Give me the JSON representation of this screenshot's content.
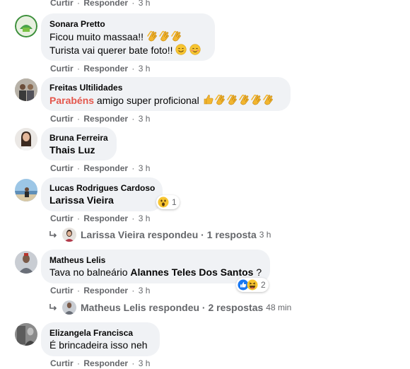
{
  "actions": {
    "like": "Curtir",
    "reply": "Responder",
    "sep": "·"
  },
  "comments": [
    {
      "id": "top",
      "time": "3 h"
    },
    {
      "id": "sonara",
      "author": "Sonara Pretto",
      "line1": "Ficou muito massaa!!",
      "line2": "Turista vai querer bate foto!!",
      "time": "3 h"
    },
    {
      "id": "freitas",
      "author": "Freitas Ultilidades",
      "highlight": "Parabéns",
      "text": " amigo super proficional",
      "time": "3 h"
    },
    {
      "id": "bruna",
      "author": "Bruna Ferreira",
      "tag": "Thais Luz",
      "time": "3 h"
    },
    {
      "id": "lucas",
      "author": "Lucas Rodrigues Cardoso",
      "tag": "Larissa Vieira",
      "reaction_count": "1",
      "time": "3 h",
      "reply_summary": {
        "text": "Larissa Vieira respondeu · 1 resposta",
        "time": "3 h"
      }
    },
    {
      "id": "matheus",
      "author": "Matheus Lelis",
      "text_before": "Tava no balneário ",
      "tag": "Alannes Teles Dos Santos",
      "text_after": " ?",
      "reaction_count": "2",
      "time": "3 h",
      "reply_summary": {
        "text": "Matheus Lelis respondeu · 2 respostas",
        "time": "48 min"
      }
    },
    {
      "id": "elizangela",
      "author": "Elizangela Francisca",
      "text": "É brincadeira isso neh",
      "time": "3 h"
    }
  ],
  "colors": {
    "bubble": "#f0f2f5",
    "meta": "#65676b",
    "highlight": "#e4574d",
    "like_blue": "#1877f2"
  }
}
